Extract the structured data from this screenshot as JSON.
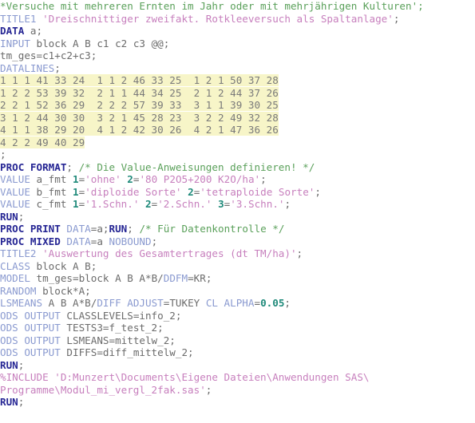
{
  "app": {
    "kind": "sas-code-editor",
    "background": "#ffffff",
    "highlight_color": "#f7f5c8"
  },
  "colors": {
    "comment": "#5aa05a",
    "proc_keyword": "#262694",
    "keyword": "#8a9ad0",
    "plain": "#6b6b6b",
    "string": "#c77fbd",
    "number": "#1f8a7a",
    "datalines_text": "#7a7a7a",
    "datalines_highlight": "#f7f5c8"
  },
  "code": {
    "lines": [
      {
        "id": "l1",
        "tokens": [
          {
            "c": "comment",
            "t": "*Versuche mit mehreren Ernten im Jahr oder mit mehrjährigen Kulturen';"
          }
        ]
      },
      {
        "id": "l2",
        "tokens": [
          {
            "c": "keyword",
            "t": "TITLE1 "
          },
          {
            "c": "string",
            "t": "'Dreischnittiger zweifakt. Rotkleeversuch als Spaltanlage'"
          },
          {
            "c": "plain",
            "t": ";"
          }
        ]
      },
      {
        "id": "l3",
        "tokens": [
          {
            "c": "proc_keyword",
            "t": "DATA"
          },
          {
            "c": "plain",
            "t": " a;"
          }
        ]
      },
      {
        "id": "l4",
        "tokens": [
          {
            "c": "keyword",
            "t": "INPUT"
          },
          {
            "c": "plain",
            "t": " block A B c1 c2 c3 @@;"
          }
        ]
      },
      {
        "id": "l5",
        "tokens": [
          {
            "c": "plain",
            "t": "tm_ges=c1+c2+c3;"
          }
        ]
      },
      {
        "id": "l6",
        "tokens": [
          {
            "c": "keyword",
            "t": "DATALINES"
          },
          {
            "c": "plain",
            "t": ";"
          }
        ]
      },
      {
        "id": "l7",
        "highlight": true,
        "tokens": [
          {
            "c": "datalines",
            "t": "1 1 1 41 33 24  1 1 2 46 33 25  1 2 1 50 37 28"
          }
        ]
      },
      {
        "id": "l8",
        "highlight": true,
        "tokens": [
          {
            "c": "datalines",
            "t": "1 2 2 53 39 32  2 1 1 44 34 25  2 1 2 44 37 26"
          }
        ]
      },
      {
        "id": "l9",
        "highlight": true,
        "tokens": [
          {
            "c": "datalines",
            "t": "2 2 1 52 36 29  2 2 2 57 39 33  3 1 1 39 30 25"
          }
        ]
      },
      {
        "id": "l10",
        "highlight": true,
        "tokens": [
          {
            "c": "datalines",
            "t": "3 1 2 44 30 30  3 2 1 45 28 23  3 2 2 49 32 28"
          }
        ]
      },
      {
        "id": "l11",
        "highlight": true,
        "tokens": [
          {
            "c": "datalines",
            "t": "4 1 1 38 29 20  4 1 2 42 30 26  4 2 1 47 36 26"
          }
        ]
      },
      {
        "id": "l12",
        "highlight": true,
        "tokens": [
          {
            "c": "datalines",
            "t": "4 2 2 49 40 29"
          }
        ]
      },
      {
        "id": "l13",
        "tokens": [
          {
            "c": "plain",
            "t": ";"
          }
        ]
      },
      {
        "id": "l14",
        "tokens": [
          {
            "c": "proc_keyword",
            "t": "PROC FORMAT"
          },
          {
            "c": "plain",
            "t": "; "
          },
          {
            "c": "comment",
            "t": "/* Die Value-Anweisungen definieren! */"
          }
        ]
      },
      {
        "id": "l15",
        "tokens": [
          {
            "c": "keyword",
            "t": "VALUE"
          },
          {
            "c": "plain",
            "t": " a_fmt "
          },
          {
            "c": "number",
            "t": "1"
          },
          {
            "c": "plain",
            "t": "="
          },
          {
            "c": "string",
            "t": "'ohne'"
          },
          {
            "c": "plain",
            "t": " "
          },
          {
            "c": "number",
            "t": "2"
          },
          {
            "c": "plain",
            "t": "="
          },
          {
            "c": "string",
            "t": "'80 P2O5+200 K2O/ha'"
          },
          {
            "c": "plain",
            "t": ";"
          }
        ]
      },
      {
        "id": "l16",
        "tokens": [
          {
            "c": "keyword",
            "t": "VALUE"
          },
          {
            "c": "plain",
            "t": " b_fmt "
          },
          {
            "c": "number",
            "t": "1"
          },
          {
            "c": "plain",
            "t": "="
          },
          {
            "c": "string",
            "t": "'diploide Sorte'"
          },
          {
            "c": "plain",
            "t": " "
          },
          {
            "c": "number",
            "t": "2"
          },
          {
            "c": "plain",
            "t": "="
          },
          {
            "c": "string",
            "t": "'tetraploide Sorte'"
          },
          {
            "c": "plain",
            "t": ";"
          }
        ]
      },
      {
        "id": "l17",
        "tokens": [
          {
            "c": "keyword",
            "t": "VALUE"
          },
          {
            "c": "plain",
            "t": " c_fmt "
          },
          {
            "c": "number",
            "t": "1"
          },
          {
            "c": "plain",
            "t": "="
          },
          {
            "c": "string",
            "t": "'1.Schn.'"
          },
          {
            "c": "plain",
            "t": " "
          },
          {
            "c": "number",
            "t": "2"
          },
          {
            "c": "plain",
            "t": "="
          },
          {
            "c": "string",
            "t": "'2.Schn.'"
          },
          {
            "c": "plain",
            "t": " "
          },
          {
            "c": "number",
            "t": "3"
          },
          {
            "c": "plain",
            "t": "="
          },
          {
            "c": "string",
            "t": "'3.Schn.'"
          },
          {
            "c": "plain",
            "t": ";"
          }
        ]
      },
      {
        "id": "l18",
        "tokens": [
          {
            "c": "proc_keyword",
            "t": "RUN"
          },
          {
            "c": "plain",
            "t": ";"
          }
        ]
      },
      {
        "id": "l19",
        "tokens": [
          {
            "c": "proc_keyword",
            "t": "PROC PRINT"
          },
          {
            "c": "plain",
            "t": " "
          },
          {
            "c": "keyword",
            "t": "DATA"
          },
          {
            "c": "plain",
            "t": "=a;"
          },
          {
            "c": "proc_keyword",
            "t": "RUN"
          },
          {
            "c": "plain",
            "t": "; "
          },
          {
            "c": "comment",
            "t": "/* Für Datenkontrolle */"
          }
        ]
      },
      {
        "id": "l20",
        "tokens": [
          {
            "c": "proc_keyword",
            "t": "PROC MIXED"
          },
          {
            "c": "plain",
            "t": " "
          },
          {
            "c": "keyword",
            "t": "DATA"
          },
          {
            "c": "plain",
            "t": "=a "
          },
          {
            "c": "keyword",
            "t": "NOBOUND"
          },
          {
            "c": "plain",
            "t": ";"
          }
        ]
      },
      {
        "id": "l21",
        "tokens": [
          {
            "c": "keyword",
            "t": "TITLE2 "
          },
          {
            "c": "string",
            "t": "'Auswertung des Gesamtertrages (dt TM/ha)'"
          },
          {
            "c": "plain",
            "t": ";"
          }
        ]
      },
      {
        "id": "l22",
        "tokens": [
          {
            "c": "keyword",
            "t": "CLASS"
          },
          {
            "c": "plain",
            "t": " block A B;"
          }
        ]
      },
      {
        "id": "l23",
        "tokens": [
          {
            "c": "keyword",
            "t": "MODEL"
          },
          {
            "c": "plain",
            "t": " tm_ges=block A B A*B/"
          },
          {
            "c": "keyword",
            "t": "DDFM"
          },
          {
            "c": "plain",
            "t": "=KR;"
          }
        ]
      },
      {
        "id": "l24",
        "tokens": [
          {
            "c": "keyword",
            "t": "RANDOM"
          },
          {
            "c": "plain",
            "t": " block*A;"
          }
        ]
      },
      {
        "id": "l25",
        "tokens": [
          {
            "c": "keyword",
            "t": "LSMEANS"
          },
          {
            "c": "plain",
            "t": " A B A*B/"
          },
          {
            "c": "keyword",
            "t": "DIFF ADJUST"
          },
          {
            "c": "plain",
            "t": "=TUKEY "
          },
          {
            "c": "keyword",
            "t": "CL ALPHA"
          },
          {
            "c": "plain",
            "t": "="
          },
          {
            "c": "number",
            "t": "0.05"
          },
          {
            "c": "plain",
            "t": ";"
          }
        ]
      },
      {
        "id": "l26",
        "tokens": [
          {
            "c": "keyword",
            "t": "ODS OUTPUT"
          },
          {
            "c": "plain",
            "t": " CLASSLEVELS=info_2;"
          }
        ]
      },
      {
        "id": "l27",
        "tokens": [
          {
            "c": "keyword",
            "t": "ODS OUTPUT"
          },
          {
            "c": "plain",
            "t": " TESTS3=f_test_2;"
          }
        ]
      },
      {
        "id": "l28",
        "tokens": [
          {
            "c": "keyword",
            "t": "ODS OUTPUT"
          },
          {
            "c": "plain",
            "t": " LSMEANS=mittelw_2;"
          }
        ]
      },
      {
        "id": "l29",
        "tokens": [
          {
            "c": "keyword",
            "t": "ODS OUTPUT"
          },
          {
            "c": "plain",
            "t": " DIFFS=diff_mittelw_2;"
          }
        ]
      },
      {
        "id": "l30",
        "tokens": [
          {
            "c": "proc_keyword",
            "t": "RUN"
          },
          {
            "c": "plain",
            "t": ";"
          }
        ]
      },
      {
        "id": "l31",
        "tokens": [
          {
            "c": "string",
            "t": "%INCLUDE 'D:Munzert\\Documents\\Eigene Dateien\\Anwendungen SAS\\"
          }
        ]
      },
      {
        "id": "l32",
        "tokens": [
          {
            "c": "string",
            "t": "Programme\\Modul_mi_vergl_2fak.sas'"
          },
          {
            "c": "plain",
            "t": ";"
          }
        ]
      },
      {
        "id": "l33",
        "tokens": [
          {
            "c": "proc_keyword",
            "t": "RUN"
          },
          {
            "c": "plain",
            "t": ";"
          }
        ]
      }
    ]
  }
}
